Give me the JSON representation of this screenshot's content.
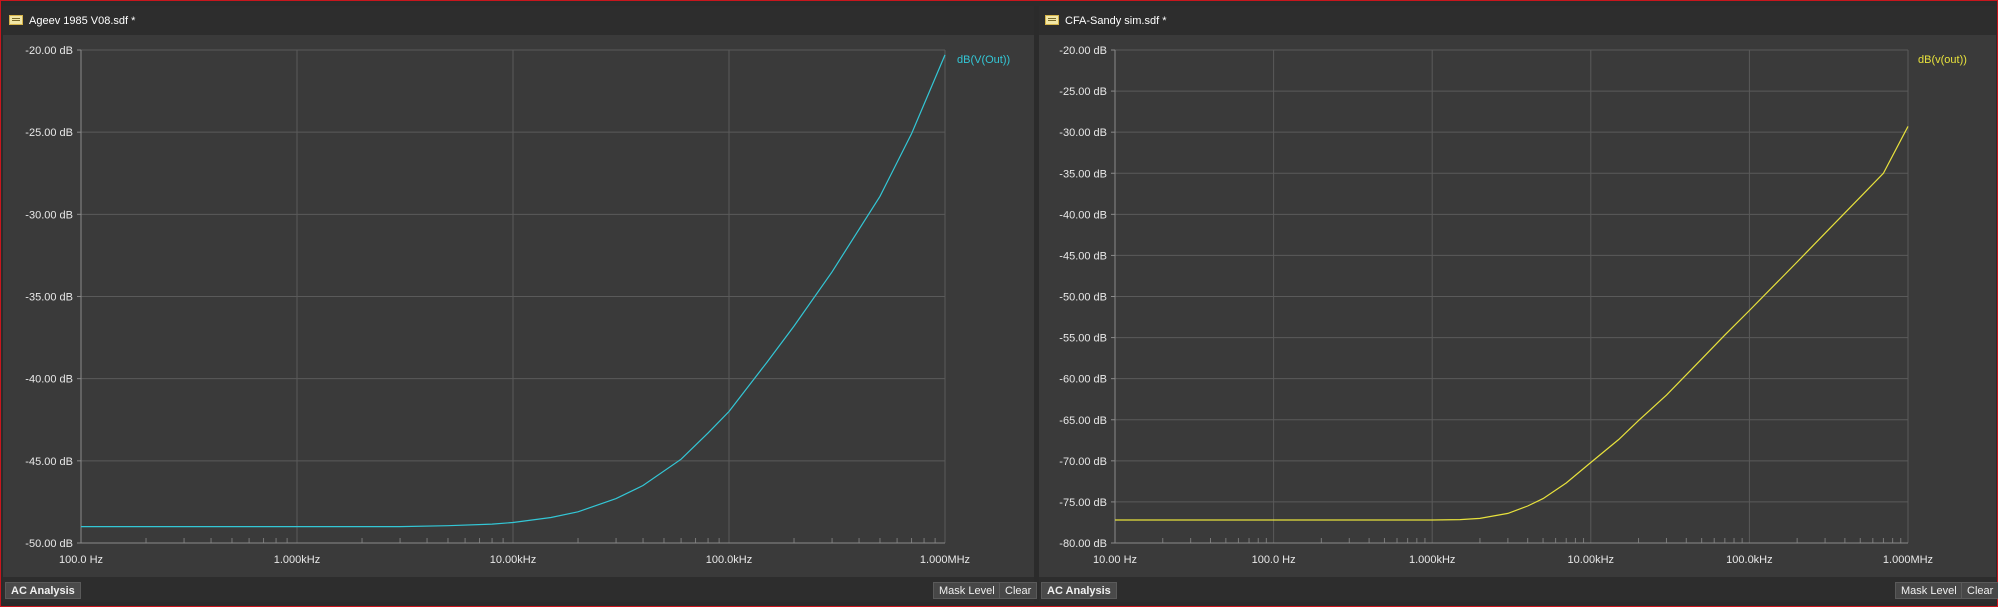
{
  "panels": [
    {
      "tab_title": "Ageev 1985 V08.sdf *",
      "tab_icon": "document-icon",
      "analysis_label": "AC Analysis",
      "mask_label": "Mask Level",
      "clear_label": "Clear",
      "chart_data": {
        "type": "line",
        "x_scale": "log",
        "xlim": [
          100,
          1000000
        ],
        "ylim": [
          -50,
          -20
        ],
        "x_ticks": [
          100,
          1000,
          10000,
          100000,
          1000000
        ],
        "x_tick_labels": [
          "100.0 Hz",
          "1.000kHz",
          "10.00kHz",
          "100.0kHz",
          "1.000MHz"
        ],
        "y_ticks": [
          -20,
          -25,
          -30,
          -35,
          -40,
          -45,
          -50
        ],
        "y_tick_labels": [
          "-20.00 dB",
          "-25.00 dB",
          "-30.00 dB",
          "-35.00 dB",
          "-40.00 dB",
          "-45.00 dB",
          "-50.00 dB"
        ],
        "grid": true,
        "legend_position": "top-right",
        "series": [
          {
            "name": "dB(V(Out))",
            "color": "#33c7d6",
            "x": [
              100,
              1000,
              3000,
              5000,
              8000,
              10000,
              15000,
              20000,
              30000,
              40000,
              60000,
              80000,
              100000,
              150000,
              200000,
              300000,
              500000,
              700000,
              1000000
            ],
            "y": [
              -49.0,
              -49.0,
              -49.0,
              -48.95,
              -48.85,
              -48.75,
              -48.45,
              -48.1,
              -47.3,
              -46.5,
              -44.9,
              -43.3,
              -42.0,
              -39.0,
              -36.8,
              -33.5,
              -28.9,
              -25.1,
              -20.3
            ]
          }
        ]
      }
    },
    {
      "tab_title": "CFA-Sandy sim.sdf *",
      "tab_icon": "document-icon",
      "analysis_label": "AC Analysis",
      "mask_label": "Mask Level",
      "clear_label": "Clear",
      "chart_data": {
        "type": "line",
        "x_scale": "log",
        "xlim": [
          10,
          1000000
        ],
        "ylim": [
          -80,
          -20
        ],
        "x_ticks": [
          10,
          100,
          1000,
          10000,
          100000,
          1000000
        ],
        "x_tick_labels": [
          "10.00 Hz",
          "100.0 Hz",
          "1.000kHz",
          "10.00kHz",
          "100.0kHz",
          "1.000MHz"
        ],
        "y_ticks": [
          -20,
          -25,
          -30,
          -35,
          -40,
          -45,
          -50,
          -55,
          -60,
          -65,
          -70,
          -75,
          -80
        ],
        "y_tick_labels": [
          "-20.00 dB",
          "-25.00 dB",
          "-30.00 dB",
          "-35.00 dB",
          "-40.00 dB",
          "-45.00 dB",
          "-50.00 dB",
          "-55.00 dB",
          "-60.00 dB",
          "-65.00 dB",
          "-70.00 dB",
          "-75.00 dB",
          "-80.00 dB"
        ],
        "grid": true,
        "legend_position": "top-right",
        "series": [
          {
            "name": "dB(v(out))",
            "color": "#e8e23c",
            "x": [
              10,
              100,
              1000,
              1500,
              2000,
              3000,
              4000,
              5000,
              7000,
              10000,
              15000,
              20000,
              30000,
              50000,
              70000,
              100000,
              200000,
              300000,
              500000,
              700000,
              1000000
            ],
            "y": [
              -77.2,
              -77.2,
              -77.2,
              -77.15,
              -77.0,
              -76.4,
              -75.5,
              -74.6,
              -72.7,
              -70.2,
              -67.4,
              -65.1,
              -62.0,
              -57.6,
              -54.7,
              -51.7,
              -45.8,
              -42.3,
              -37.9,
              -35.0,
              -29.3
            ]
          }
        ]
      }
    }
  ]
}
